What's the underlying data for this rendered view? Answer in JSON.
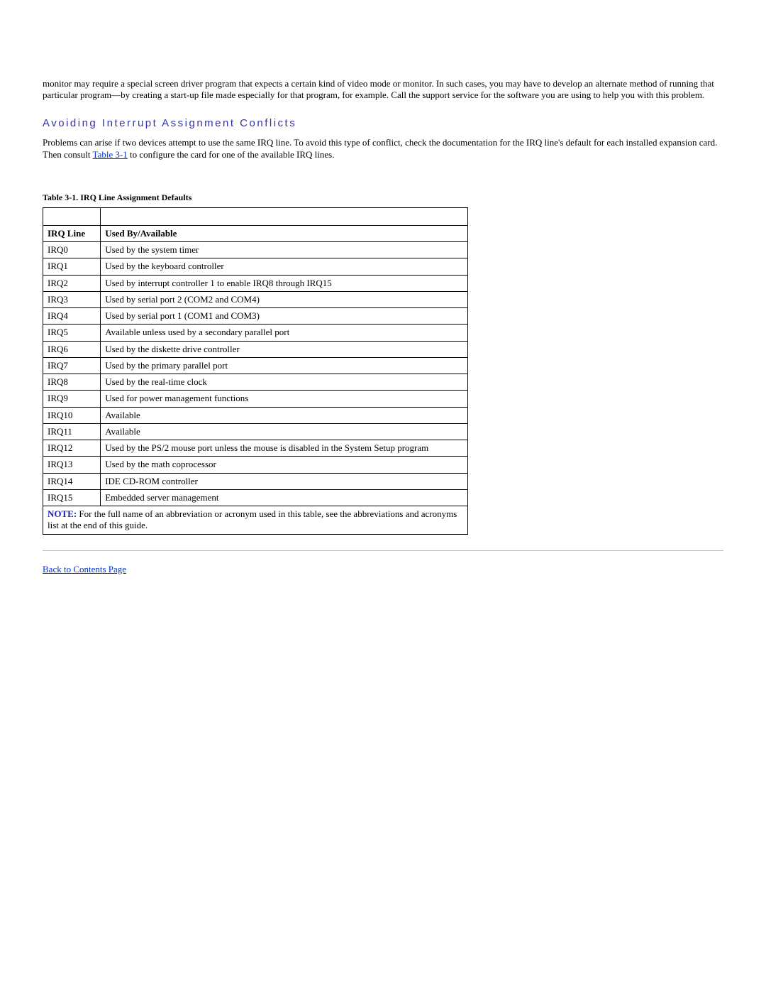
{
  "intro_para": "monitor may require a special screen driver program that expects a certain kind of video mode or monitor. In such cases, you may have to develop an alternate method of running that particular program—by creating a start-up file made especially for that program, for example. Call the support service for the software you are using to help you with this problem.",
  "section_heading": "Avoiding Interrupt Assignment Conflicts",
  "conflict_para_a": "Problems can arise if two devices attempt to use the same IRQ line. To avoid this type of conflict, check the documentation for the IRQ line's default for each installed expansion card. Then consult ",
  "conflict_link_text": "Table 3-1",
  "conflict_para_b": " to configure the card for one of the available IRQ lines.",
  "table_caption": "Table 3-1. IRQ Line Assignment Defaults",
  "table_headers": {
    "col1": "IRQ Line",
    "col2": "Used By/Available"
  },
  "rows": [
    {
      "irq": "IRQ0",
      "use": "Used by the system timer"
    },
    {
      "irq": "IRQ1",
      "use": "Used by the keyboard controller"
    },
    {
      "irq": "IRQ2",
      "use": "Used by interrupt controller 1 to enable IRQ8 through IRQ15"
    },
    {
      "irq": "IRQ3",
      "use": "Used by serial port 2 (COM2 and COM4)"
    },
    {
      "irq": "IRQ4",
      "use": "Used by serial port 1 (COM1 and COM3)"
    },
    {
      "irq": "IRQ5",
      "use": "Available unless used by a secondary parallel port"
    },
    {
      "irq": "IRQ6",
      "use": "Used by the diskette drive controller"
    },
    {
      "irq": "IRQ7",
      "use": "Used by the primary parallel port"
    },
    {
      "irq": "IRQ8",
      "use": "Used by the real-time clock"
    },
    {
      "irq": "IRQ9",
      "use": "Used for power management functions"
    },
    {
      "irq": "IRQ10",
      "use": "Available"
    },
    {
      "irq": "IRQ11",
      "use": "Available"
    },
    {
      "irq": "IRQ12",
      "use": "Used by the PS/2 mouse port unless the mouse is disabled in the System Setup program"
    },
    {
      "irq": "IRQ13",
      "use": "Used by the math coprocessor"
    },
    {
      "irq": "IRQ14",
      "use": "IDE CD-ROM controller"
    },
    {
      "irq": "IRQ15",
      "use": "Embedded server management"
    }
  ],
  "note_label": "NOTE:",
  "note_text": " For the full name of an abbreviation or acronym used in this table, see the abbreviations and acronyms list at the end of this guide.",
  "back_link": "Back to Contents Page"
}
